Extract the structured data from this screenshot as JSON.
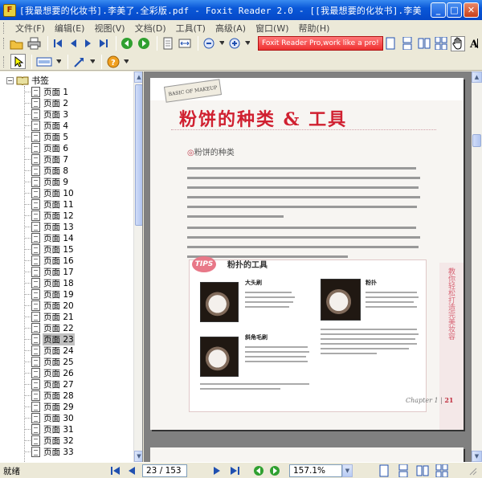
{
  "window": {
    "title": "[我最想要的化妆书].李美了.全彩版.pdf - Foxit Reader 2.0 - [[我最想要的化妆书].李美了.全...",
    "min_label": "_",
    "max_label": "□",
    "close_label": "✕"
  },
  "menu": [
    {
      "id": "file",
      "label": "文件(F)"
    },
    {
      "id": "edit",
      "label": "编辑(E)"
    },
    {
      "id": "view",
      "label": "视图(V)"
    },
    {
      "id": "document",
      "label": "文档(D)"
    },
    {
      "id": "tools",
      "label": "工具(T)"
    },
    {
      "id": "advanced",
      "label": "高级(A)"
    },
    {
      "id": "window",
      "label": "窗口(W)"
    },
    {
      "id": "help",
      "label": "帮助(H)"
    }
  ],
  "toolbar": {
    "banner": "Foxit Reader Pro,work like a pro!"
  },
  "bookmarks": {
    "root_label": "书签",
    "items": [
      "页面 1",
      "页面 2",
      "页面 3",
      "页面 4",
      "页面 5",
      "页面 6",
      "页面 7",
      "页面 8",
      "页面 9",
      "页面 10",
      "页面 11",
      "页面 12",
      "页面 13",
      "页面 14",
      "页面 15",
      "页面 16",
      "页面 17",
      "页面 18",
      "页面 19",
      "页面 20",
      "页面 21",
      "页面 22",
      "页面 23",
      "页面 24",
      "页面 25",
      "页面 26",
      "页面 27",
      "页面 28",
      "页面 29",
      "页面 30",
      "页面 31",
      "页面 32",
      "页面 33"
    ],
    "selected_index": 22
  },
  "pdf": {
    "logo": "BASIC OF MAKEUP",
    "title": "粉饼的种类 & 工具",
    "section": "粉饼的种类",
    "tips_label": "TIPS",
    "tips_title": "粉扑的工具",
    "tip1": "大头刷",
    "tip2": "粉扑",
    "tip3": "斜角毛刷",
    "side_text": "教你轻松打造完美妆容",
    "chapter": "Chapter 1",
    "page_no": "21"
  },
  "status": {
    "text": "就绪",
    "page_field": "23 / 153",
    "zoom_field": "157.1%"
  }
}
